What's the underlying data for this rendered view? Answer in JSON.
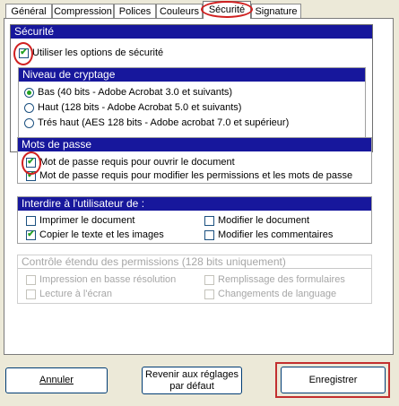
{
  "tabs": [
    {
      "label": "Général",
      "active": false
    },
    {
      "label": "Compression",
      "active": false
    },
    {
      "label": "Polices",
      "active": false
    },
    {
      "label": "Couleurs",
      "active": false
    },
    {
      "label": "Sécurité",
      "active": true
    },
    {
      "label": "Signature",
      "active": false
    }
  ],
  "security": {
    "title": "Sécurité",
    "use_options_label": "Utiliser les options de sécurité",
    "use_options_checked": true,
    "encryption": {
      "title": "Niveau de cryptage",
      "options": [
        {
          "label": "Bas (40 bits - Adobe Acrobat 3.0 et suivants)",
          "selected": true
        },
        {
          "label": "Haut (128 bits - Adobe Acrobat 5.0 et suivants)",
          "selected": false
        },
        {
          "label": "Trés haut (AES 128 bits - Adobe acrobat 7.0 et supérieur)",
          "selected": false
        }
      ]
    }
  },
  "passwords": {
    "title": "Mots de passe",
    "open_label": "Mot de passe requis pour ouvrir le document",
    "open_checked": true,
    "permissions_label": "Mot de passe requis pour modifier les permissions et les mots de passe",
    "permissions_checked": true
  },
  "restrictions": {
    "title": "Interdire à l'utilisateur de :",
    "items": [
      {
        "label": "Imprimer le document",
        "checked": false
      },
      {
        "label": "Modifier le document",
        "checked": false
      },
      {
        "label": "Copier le texte et les images",
        "checked": true
      },
      {
        "label": "Modifier les commentaires",
        "checked": false
      }
    ]
  },
  "extended": {
    "title": "Contrôle étendu des permissions (128 bits uniquement)",
    "items": [
      {
        "label": "Impression en basse résolution",
        "checked": false
      },
      {
        "label": "Remplissage des formulaires",
        "checked": false
      },
      {
        "label": "Lecture à l'écran",
        "checked": false
      },
      {
        "label": "Changements de language",
        "checked": false
      }
    ]
  },
  "buttons": {
    "cancel": "Annuler",
    "reset_line1": "Revenir aux réglages",
    "reset_line2": "par défaut",
    "save": "Enregistrer"
  },
  "colors": {
    "header_bg": "#17179c",
    "check_color": "#21a121",
    "highlight_ring": "#d02020",
    "disabled_text": "#a6a6a6"
  }
}
